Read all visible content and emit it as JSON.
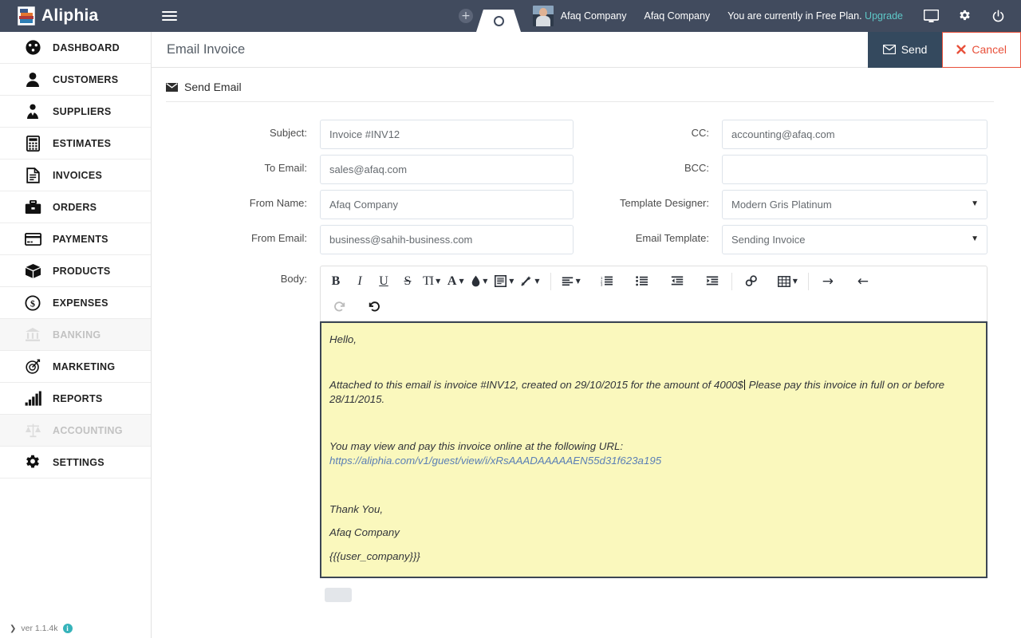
{
  "topbar": {
    "brand": "Aliphia",
    "menu_icon": "hamburger-icon",
    "tab_add_label": "+",
    "company_primary": "Afaq Company",
    "company_secondary": "Afaq Company",
    "plan_text": "You are currently in Free Plan.",
    "upgrade_label": "Upgrade",
    "icons": [
      "monitor-icon",
      "gear-icon",
      "power-icon"
    ],
    "background_color": "#414b5e"
  },
  "sidebar": {
    "items": [
      {
        "label": "DASHBOARD",
        "icon": "dashboard-icon",
        "disabled": false
      },
      {
        "label": "CUSTOMERS",
        "icon": "user-icon",
        "disabled": false
      },
      {
        "label": "SUPPLIERS",
        "icon": "supplier-icon",
        "disabled": false
      },
      {
        "label": "ESTIMATES",
        "icon": "calculator-icon",
        "disabled": false
      },
      {
        "label": "INVOICES",
        "icon": "document-icon",
        "disabled": false
      },
      {
        "label": "ORDERS",
        "icon": "briefcase-icon",
        "disabled": false
      },
      {
        "label": "PAYMENTS",
        "icon": "credit-card-icon",
        "disabled": false
      },
      {
        "label": "PRODUCTS",
        "icon": "box-icon",
        "disabled": false
      },
      {
        "label": "EXPENSES",
        "icon": "dollar-coin-icon",
        "disabled": false
      },
      {
        "label": "BANKING",
        "icon": "bank-icon",
        "disabled": true
      },
      {
        "label": "MARKETING",
        "icon": "target-icon",
        "disabled": false
      },
      {
        "label": "REPORTS",
        "icon": "bar-chart-icon",
        "disabled": false
      },
      {
        "label": "ACCOUNTING",
        "icon": "scales-icon",
        "disabled": true
      },
      {
        "label": "SETTINGS",
        "icon": "gear-icon",
        "disabled": false
      }
    ],
    "version": "ver 1.1.4k",
    "version_prompt": "❯",
    "info_badge": "i"
  },
  "page": {
    "title": "Email Invoice",
    "send_label": "Send",
    "cancel_label": "Cancel",
    "send_icon": "envelope-icon",
    "cancel_icon": "x-mark-icon",
    "send_bg": "#34495e",
    "cancel_color": "#e8503a"
  },
  "panel": {
    "heading": "Send Email",
    "heading_icon": "envelope-icon"
  },
  "form": {
    "subject": {
      "label": "Subject:",
      "value": "Invoice #INV12",
      "placeholder": "Subject"
    },
    "to_email": {
      "label": "To Email:",
      "value": "sales@afaq.com",
      "placeholder": "To Email"
    },
    "from_name": {
      "label": "From Name:",
      "value": "Afaq Company",
      "placeholder": "From Name"
    },
    "from_email": {
      "label": "From Email:",
      "value": "business@sahih-business.com",
      "placeholder": "From Email"
    },
    "cc": {
      "label": "CC:",
      "value": "accounting@afaq.com",
      "placeholder": "CC"
    },
    "bcc": {
      "label": "BCC:",
      "value": "",
      "placeholder": ""
    },
    "template_designer": {
      "label": "Template Designer:",
      "value": "Modern Gris Platinum",
      "options": [
        "Modern Gris Platinum"
      ]
    },
    "email_template": {
      "label": "Email Template:",
      "value": "Sending Invoice",
      "options": [
        "Sending Invoice"
      ]
    },
    "body_label": "Body:"
  },
  "editor": {
    "toolbar_row1": [
      {
        "name": "bold-icon",
        "glyph": "B",
        "style": "bold",
        "caret": false,
        "disabled": false
      },
      {
        "name": "italic-icon",
        "glyph": "I",
        "style": "italic",
        "caret": false,
        "disabled": false
      },
      {
        "name": "underline-icon",
        "glyph": "U",
        "style": "underline",
        "caret": false,
        "disabled": false
      },
      {
        "name": "strikethrough-icon",
        "glyph": "S",
        "style": "strike",
        "caret": false,
        "disabled": false
      },
      {
        "name": "font-size-icon",
        "glyph": "TI",
        "style": "plain",
        "caret": true,
        "disabled": false
      },
      {
        "name": "font-color-icon",
        "glyph": "A",
        "style": "plain",
        "caret": true,
        "disabled": false
      },
      {
        "name": "highlight-color-icon",
        "glyph": "drop",
        "style": "svg",
        "caret": true,
        "disabled": false
      },
      {
        "name": "paragraph-style-icon",
        "glyph": "doc",
        "style": "svg",
        "caret": true,
        "disabled": false
      },
      {
        "name": "clear-format-icon",
        "glyph": "wand",
        "style": "svg",
        "caret": true,
        "disabled": false
      },
      {
        "name": "align-icon",
        "glyph": "align",
        "style": "svg",
        "caret": true,
        "disabled": false
      },
      {
        "name": "ordered-list-icon",
        "glyph": "ol",
        "style": "svg",
        "caret": false,
        "disabled": false
      },
      {
        "name": "unordered-list-icon",
        "glyph": "ul",
        "style": "svg",
        "caret": false,
        "disabled": false
      },
      {
        "name": "outdent-icon",
        "glyph": "outdent",
        "style": "svg",
        "caret": false,
        "disabled": false
      },
      {
        "name": "indent-icon",
        "glyph": "indent",
        "style": "svg",
        "caret": false,
        "disabled": false
      },
      {
        "name": "link-icon",
        "glyph": "link",
        "style": "svg",
        "caret": false,
        "disabled": false
      },
      {
        "name": "table-icon",
        "glyph": "table",
        "style": "svg",
        "caret": true,
        "disabled": false
      },
      {
        "name": "ltr-direction-icon",
        "glyph": "→",
        "style": "arrow",
        "caret": false,
        "disabled": false
      },
      {
        "name": "rtl-direction-icon",
        "glyph": "←",
        "style": "arrow",
        "caret": false,
        "disabled": false
      }
    ],
    "toolbar_row2": [
      {
        "name": "redo-icon",
        "glyph": "redo",
        "style": "svg",
        "caret": false,
        "disabled": true
      },
      {
        "name": "undo-icon",
        "glyph": "undo",
        "style": "svg",
        "caret": false,
        "disabled": false
      }
    ],
    "body": {
      "greeting": "Hello,",
      "paragraph_1a": "Attached to this email is invoice #INV12, created on 29/10/2015 for the amount of 4000$",
      "paragraph_1b": " Please pay this invoice in full on or before 28/11/2015.",
      "paragraph_2": "You may view and pay this invoice online at the following URL:",
      "url": "https://aliphia.com/v1/guest/view/i/xRsAAADAAAAAEN55d31f623a195",
      "closing": "Thank You,",
      "signature": "Afaq Company",
      "variable": "{{{user_company}}}",
      "background_color": "#faf8bd",
      "border_color": "#3c4654"
    }
  }
}
